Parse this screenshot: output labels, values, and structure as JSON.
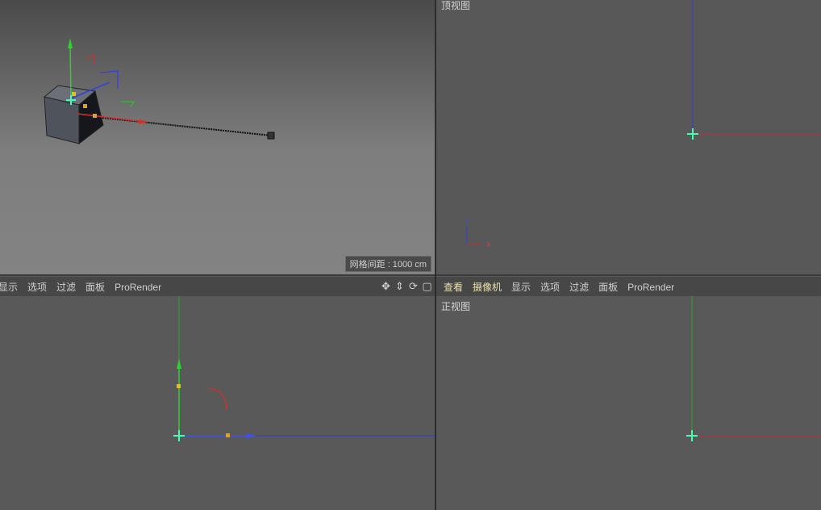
{
  "viewports": {
    "perspective": {
      "grid_info": "网格间距 : 1000 cm"
    },
    "top": {
      "label": "顶视图",
      "axis_labels": {
        "z": "Z",
        "x": "X"
      }
    },
    "front": {
      "label": "正视图"
    }
  },
  "menubar_left": {
    "items": [
      "显示",
      "选项",
      "过滤",
      "面板",
      "ProRender"
    ],
    "nav_icons": [
      "move-icon",
      "zoom-icon",
      "rotate-icon",
      "maximize-icon"
    ]
  },
  "menubar_right": {
    "items": [
      "查看",
      "摄像机",
      "显示",
      "选项",
      "过滤",
      "面板",
      "ProRender"
    ]
  },
  "colors": {
    "axis_x": "#c03030",
    "axis_y": "#30c030",
    "axis_z": "#3040d0",
    "cursor": "#40ffb0",
    "handle": "#e0a020"
  }
}
